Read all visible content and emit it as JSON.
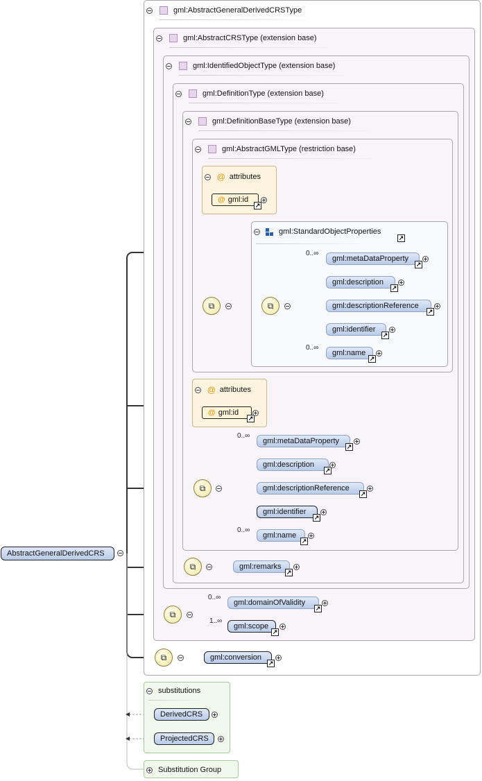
{
  "root": {
    "label": "AbstractGeneralDerivedCRS"
  },
  "types": {
    "outer": "gml:AbstractGeneralDerivedCRSType",
    "crs": "gml:AbstractCRSType (extension base)",
    "identified": "gml:IdentifiedObjectType (extension base)",
    "definition": "gml:DefinitionType (extension base)",
    "definition_base": "gml:DefinitionBaseType (extension base)",
    "gml_type": "gml:AbstractGMLType (restriction base)"
  },
  "attributes_label": "attributes",
  "attr_symbol": "@",
  "attr_id": "gml:id",
  "group": {
    "label": "gml:StandardObjectProperties"
  },
  "group_elements": [
    {
      "label": "gml:metaDataProperty",
      "occurs": "0..∞"
    },
    {
      "label": "gml:description",
      "occurs": ""
    },
    {
      "label": "gml:descriptionReference",
      "occurs": ""
    },
    {
      "label": "gml:identifier",
      "occurs": ""
    },
    {
      "label": "gml:name",
      "occurs": "0..∞"
    }
  ],
  "def_elements": [
    {
      "label": "gml:metaDataProperty",
      "occurs": "0..∞"
    },
    {
      "label": "gml:description",
      "occurs": ""
    },
    {
      "label": "gml:descriptionReference",
      "occurs": ""
    },
    {
      "label": "gml:identifier",
      "occurs": ""
    },
    {
      "label": "gml:name",
      "occurs": "0..∞"
    }
  ],
  "remarks": "gml:remarks",
  "crs_elements": [
    {
      "label": "gml:domainOfValidity",
      "occurs": "0..∞"
    },
    {
      "label": "gml:scope",
      "occurs": "1..∞"
    }
  ],
  "conversion": "gml:conversion",
  "substitutions": {
    "label": "substitutions",
    "items": [
      "DerivedCRS",
      "ProjectedCRS"
    ]
  },
  "substitution_group": "Substitution Group",
  "colors": {
    "type_box": "#f8f4f9",
    "attr_box": "#fcf4de",
    "pill_top": "#dfe8f8",
    "pill_bottom": "#b9cbe8",
    "subst_box": "#f0f9ec"
  }
}
